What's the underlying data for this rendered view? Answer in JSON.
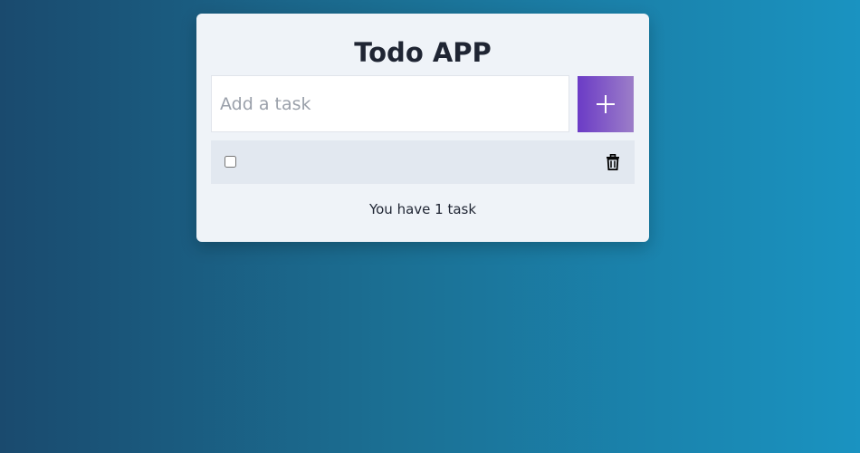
{
  "app": {
    "title": "Todo APP"
  },
  "input": {
    "placeholder": "Add a task",
    "value": ""
  },
  "add_button": {
    "icon": "plus-icon"
  },
  "tasks": [
    {
      "text": "",
      "completed": false,
      "delete_icon": "trash-icon"
    }
  ],
  "footer": {
    "count_text": "You have 1 task"
  },
  "colors": {
    "background_start": "#1a4a6e",
    "background_end": "#1a93c1",
    "card": "#eff3f8",
    "task_row": "#e2e8f0",
    "add_button_start": "#6b3bc6",
    "add_button_end": "#9c7ec8"
  }
}
